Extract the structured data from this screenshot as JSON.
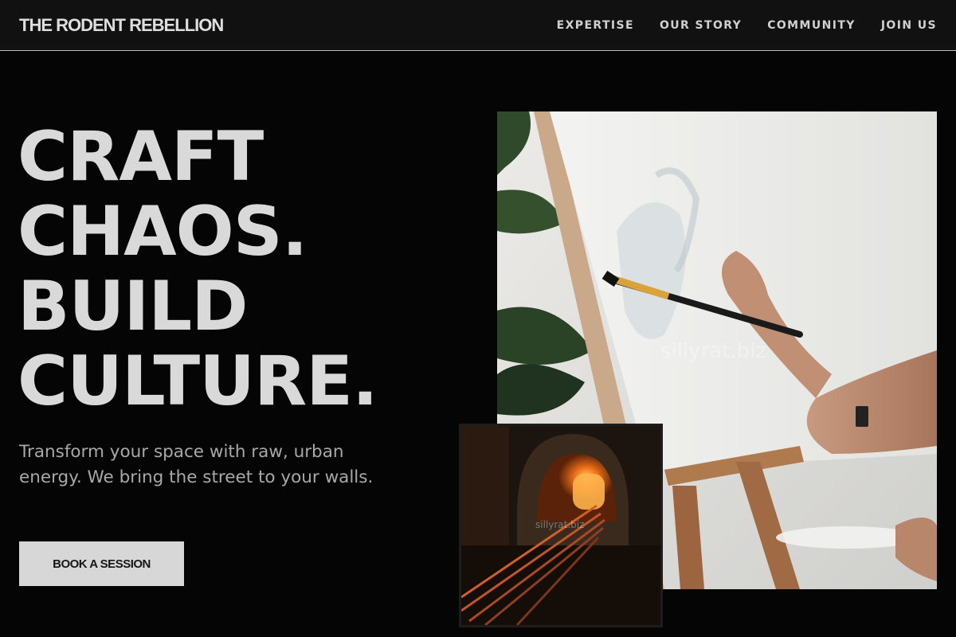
{
  "header": {
    "brand": "THE RODENT REBELLION",
    "nav": [
      {
        "label": "EXPERTISE"
      },
      {
        "label": "OUR STORY"
      },
      {
        "label": "COMMUNITY"
      },
      {
        "label": "JOIN US"
      }
    ]
  },
  "hero": {
    "headline_lines": [
      "CRAFT",
      "CHAOS.",
      "BUILD",
      "CULTURE."
    ],
    "subtext": "Transform your space with raw, urban energy. We bring the street to your walls.",
    "cta_label": "BOOK A SESSION"
  },
  "images": {
    "main_watermark": "sillyrat.biz",
    "inset_watermark": "sillyrat.biz"
  },
  "colors": {
    "background": "#050505",
    "header_bg": "#111111",
    "headline": "#d9d9d9",
    "cta_bg": "#d7d7d7"
  }
}
